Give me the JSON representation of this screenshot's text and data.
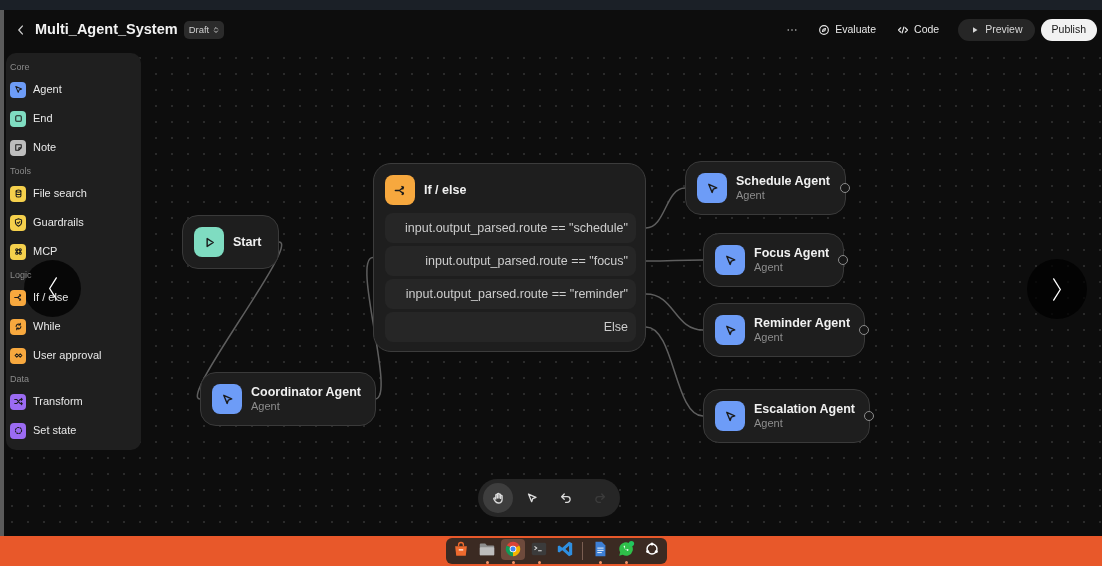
{
  "header": {
    "title": "Multi_Agent_System",
    "status": "Draft",
    "actions": [
      {
        "kind": "more"
      },
      {
        "kind": "evaluate",
        "label": "Evaluate"
      },
      {
        "kind": "code",
        "label": "Code"
      },
      {
        "kind": "preview",
        "label": "Preview"
      },
      {
        "kind": "publish",
        "label": "Publish"
      }
    ]
  },
  "palette": {
    "sections": [
      {
        "title": "Core",
        "items": [
          {
            "kind": "agent",
            "label": "Agent",
            "color": "#6d9cf7"
          },
          {
            "kind": "end",
            "label": "End",
            "color": "#7fdcc1"
          },
          {
            "kind": "note",
            "label": "Note",
            "color": "#bdbdbd"
          }
        ]
      },
      {
        "title": "Tools",
        "items": [
          {
            "kind": "file_search",
            "label": "File search",
            "color": "#f5d04c"
          },
          {
            "kind": "guardrails",
            "label": "Guardrails",
            "color": "#f5d04c"
          },
          {
            "kind": "mcp",
            "label": "MCP",
            "color": "#f5d04c"
          }
        ]
      },
      {
        "title": "Logic",
        "items": [
          {
            "kind": "if_else",
            "label": "If / else",
            "color": "#f7a83e"
          },
          {
            "kind": "while",
            "label": "While",
            "color": "#f7a83e"
          },
          {
            "kind": "user_approval",
            "label": "User approval",
            "color": "#f7a83e"
          }
        ]
      },
      {
        "title": "Data",
        "items": [
          {
            "kind": "transform",
            "label": "Transform",
            "color": "#9b6bf2"
          },
          {
            "kind": "set_state",
            "label": "Set state",
            "color": "#9b6bf2"
          }
        ]
      }
    ]
  },
  "canvas": {
    "nodes": [
      {
        "kind": "start",
        "title": "Start",
        "color": "#7fdcc1"
      },
      {
        "kind": "agent",
        "title": "Coordinator Agent",
        "subtitle": "Agent",
        "color": "#6d9cf7"
      },
      {
        "kind": "if_else",
        "title": "If / else",
        "color": "#f7a83e",
        "branches": [
          "input.output_parsed.route == \"schedule\"",
          "input.output_parsed.route == \"focus\"",
          "input.output_parsed.route == \"reminder\"",
          "Else"
        ]
      },
      {
        "kind": "agent",
        "title": "Schedule Agent",
        "subtitle": "Agent",
        "color": "#6d9cf7"
      },
      {
        "kind": "agent",
        "title": "Focus Agent",
        "subtitle": "Agent",
        "color": "#6d9cf7"
      },
      {
        "kind": "agent",
        "title": "Reminder Agent",
        "subtitle": "Agent",
        "color": "#6d9cf7"
      },
      {
        "kind": "agent",
        "title": "Escalation Agent",
        "subtitle": "Agent",
        "color": "#6d9cf7"
      }
    ]
  },
  "toolbar": [
    {
      "kind": "hand",
      "selected": true,
      "disabled": false
    },
    {
      "kind": "pointer",
      "selected": false,
      "disabled": false
    },
    {
      "kind": "undo",
      "selected": false,
      "disabled": false
    },
    {
      "kind": "redo",
      "selected": false,
      "disabled": true
    }
  ],
  "dock": {
    "pinned": [
      {
        "kind": "store",
        "selected": false,
        "running": false
      },
      {
        "kind": "files",
        "selected": false,
        "running": true
      },
      {
        "kind": "browser",
        "selected": true,
        "running": true
      },
      {
        "kind": "terminal",
        "selected": false,
        "running": true
      },
      {
        "kind": "editor",
        "selected": false,
        "running": false
      }
    ],
    "other": [
      {
        "kind": "document",
        "selected": false,
        "running": true
      },
      {
        "kind": "chat",
        "selected": false,
        "running": true
      },
      {
        "kind": "launcher",
        "selected": false,
        "running": false
      }
    ]
  }
}
